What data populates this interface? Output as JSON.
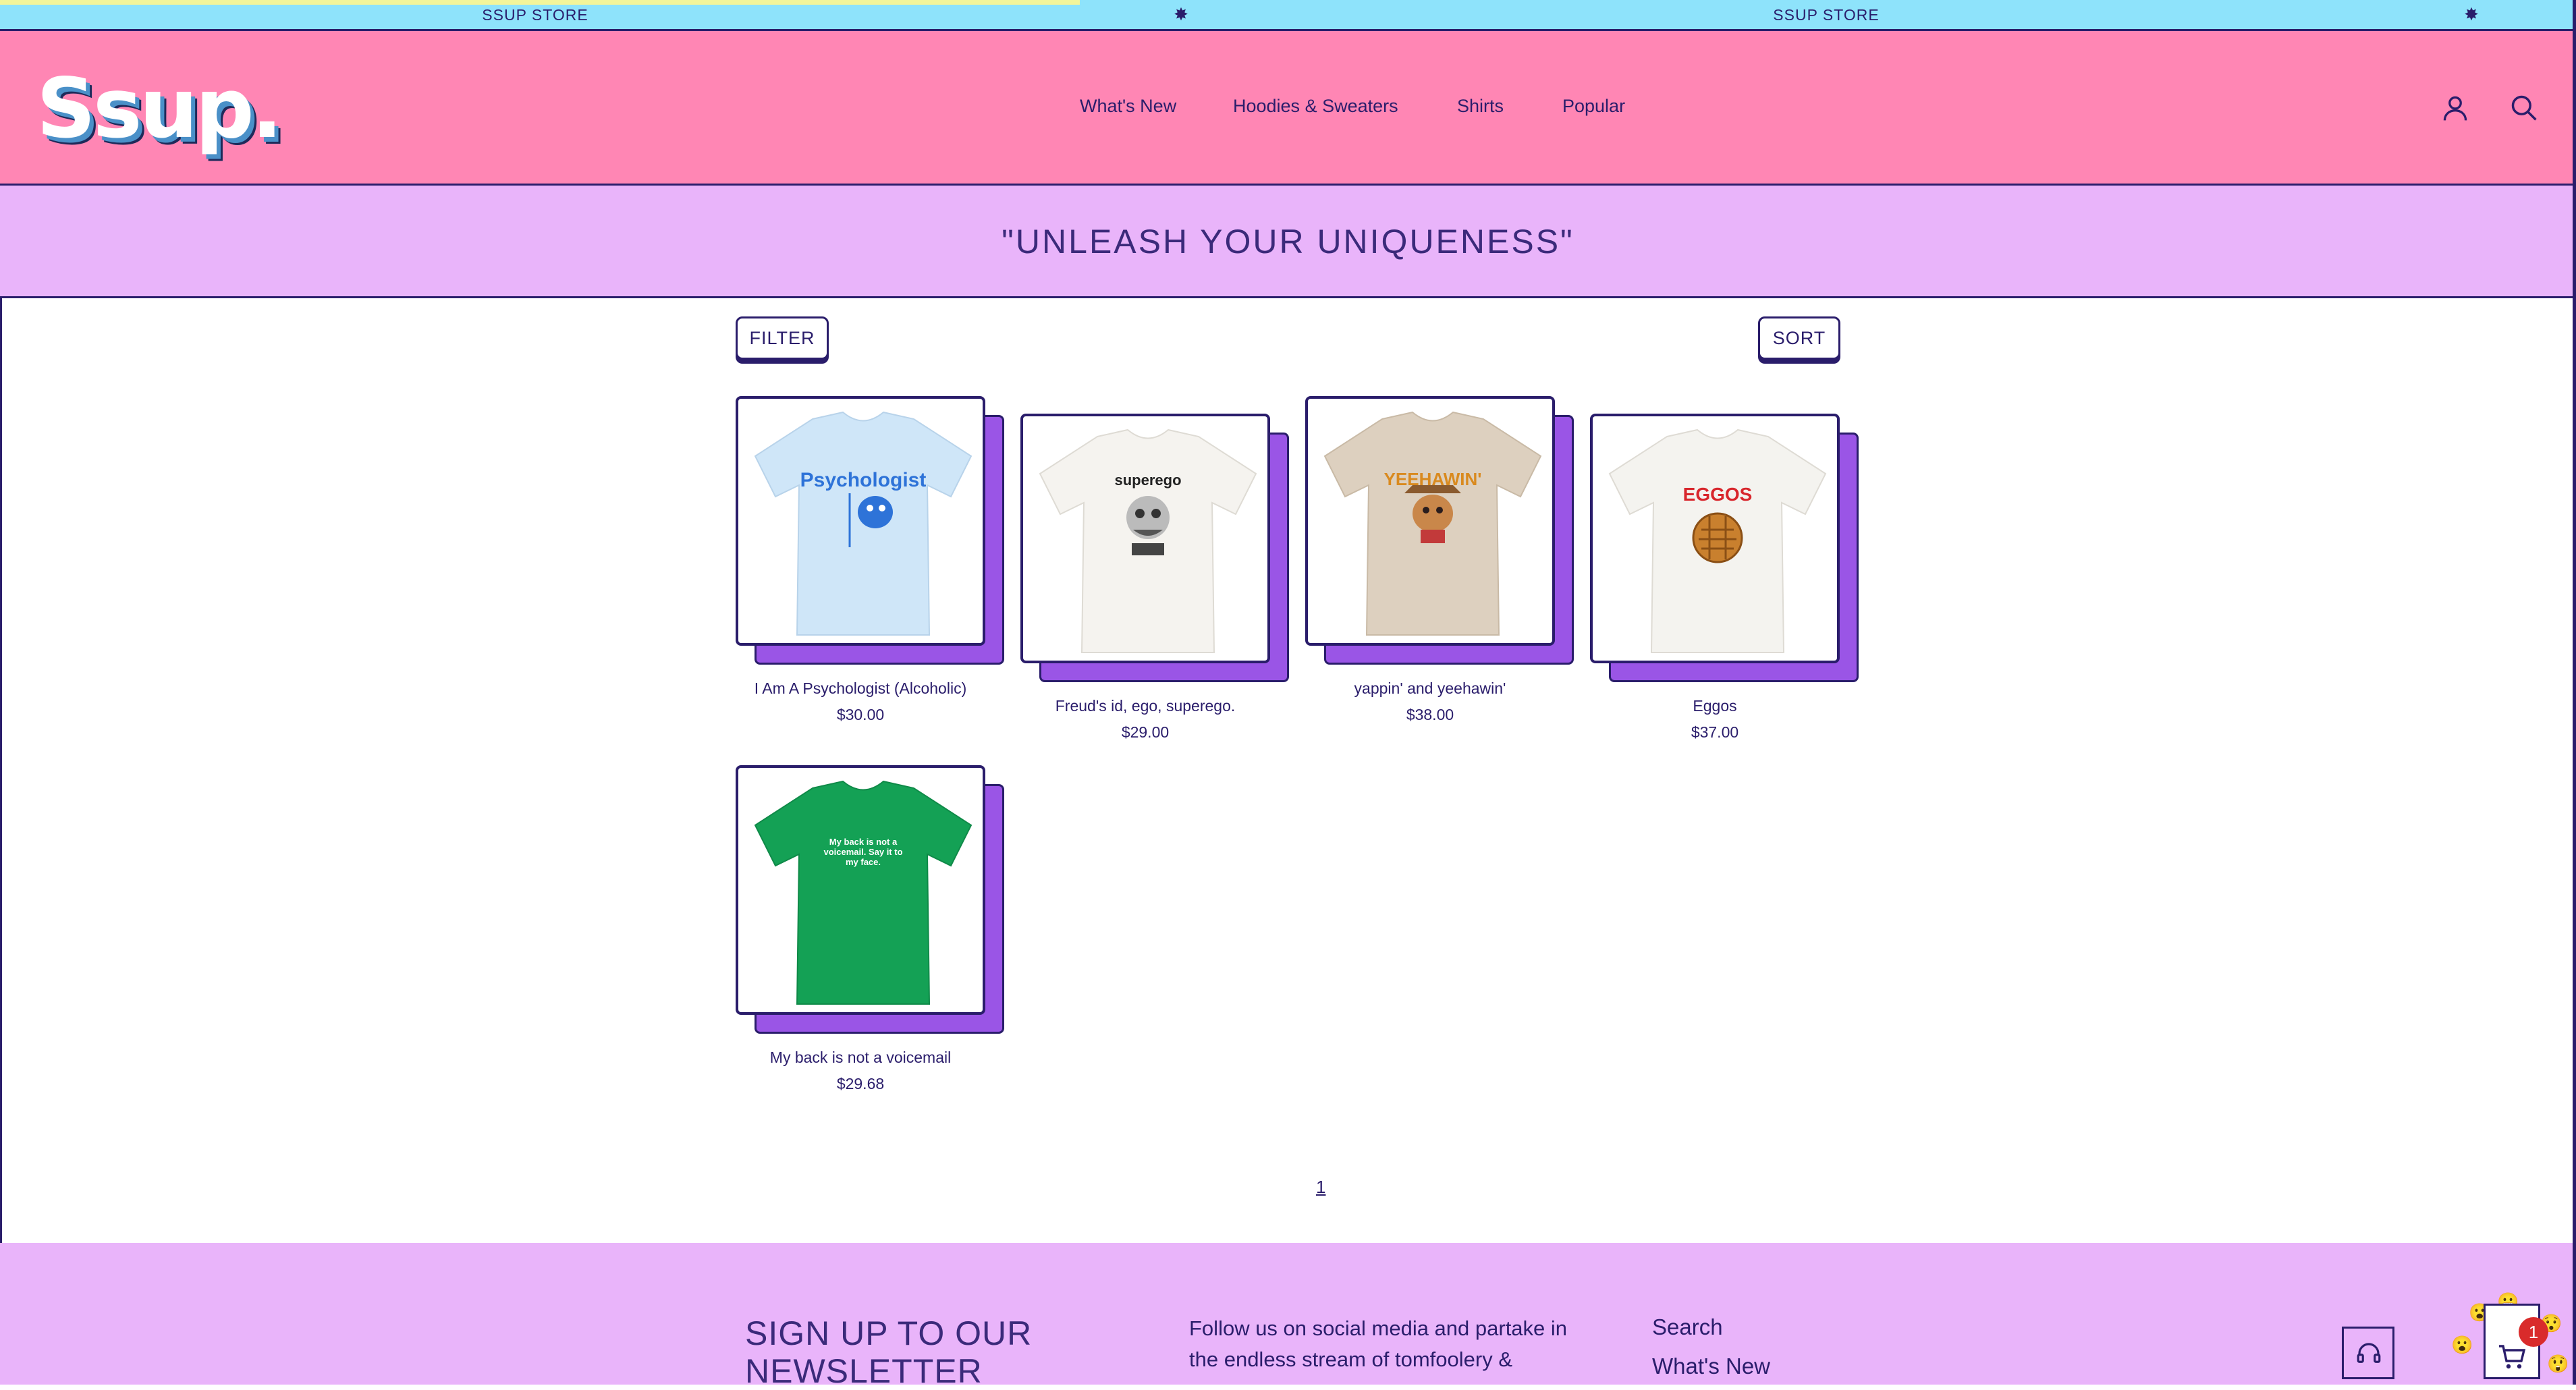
{
  "announcement": {
    "items": [
      "SSUP STORE",
      "SSUP STORE"
    ]
  },
  "header": {
    "logo": "Ssup.",
    "nav": [
      "What's New",
      "Hoodies & Sweaters",
      "Shirts",
      "Popular"
    ],
    "icons": [
      "account-icon",
      "search-icon"
    ]
  },
  "hero": {
    "tagline": "\"UNLEASH YOUR UNIQUENESS\""
  },
  "toolbar": {
    "filter_label": "FILTER",
    "sort_label": "SORT"
  },
  "products": [
    {
      "title": "I Am A Psychologist (Alcoholic)",
      "price": "$30.00",
      "shirt_color": "#cfe6f8",
      "print_text": "Psychologist"
    },
    {
      "title": "Freud's id, ego, superego.",
      "price": "$29.00",
      "shirt_color": "#f5f3ef",
      "print_text": "superego"
    },
    {
      "title": "yappin' and yeehawin'",
      "price": "$38.00",
      "shirt_color": "#ddd0bf",
      "print_text": "YEEHAWIN'"
    },
    {
      "title": "Eggos",
      "price": "$37.00",
      "shirt_color": "#f4f3ef",
      "print_text": "EGGOS"
    },
    {
      "title": "My back is not a voicemail",
      "price": "$29.68",
      "shirt_color": "#14a155",
      "print_text": "My back is not a voicemail. Say it to my face."
    }
  ],
  "pagination": {
    "current": "1"
  },
  "footer": {
    "newsletter_title": "SIGN UP TO OUR NEWSLETTER",
    "social_text": "Follow us on social media and partake in the endless stream of tomfoolery &",
    "links": [
      "Search",
      "What's New"
    ]
  },
  "cart": {
    "count": "1"
  },
  "colors": {
    "announcement_bg": "#8ee3fb",
    "header_bg": "#ff86b4",
    "hero_bg": "#e9b4fa",
    "accent_purple": "#9a55e6",
    "ink": "#2a1d6b"
  }
}
